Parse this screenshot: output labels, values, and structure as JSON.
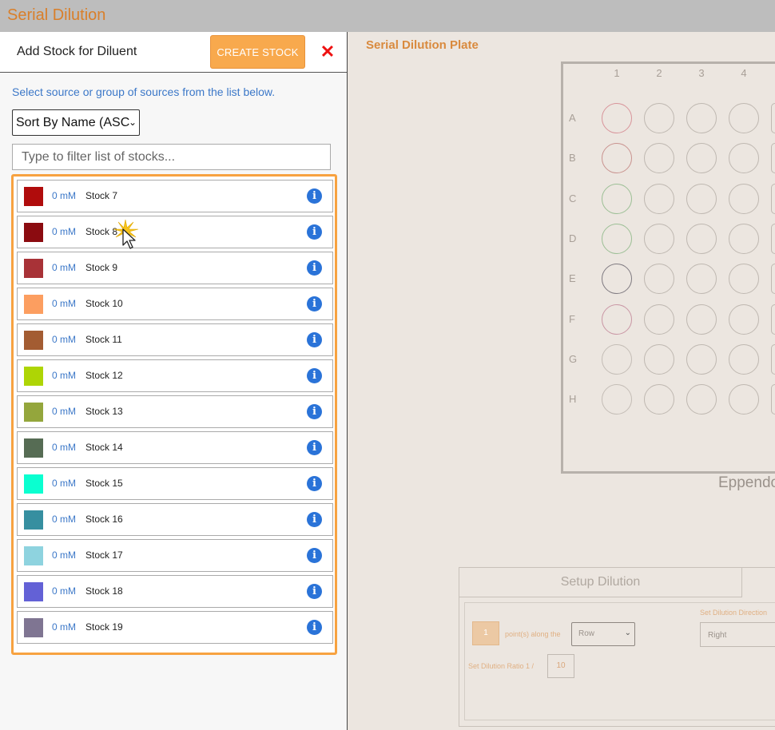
{
  "app": {
    "title": "Serial Dilution"
  },
  "panel": {
    "title": "Add Stock for Diluent",
    "create_label": "CREATE STOCK",
    "close_glyph": "✕",
    "instructions": "Select source or group of sources from the list below.",
    "sort_value": "Sort By Name (ASC",
    "filter_placeholder": "Type to filter list of stocks..."
  },
  "stocks": [
    {
      "conc": "0 mM",
      "name": "Stock 7",
      "color": "#b00c0c"
    },
    {
      "conc": "0 mM",
      "name": "Stock 8",
      "color": "#8b0b10"
    },
    {
      "conc": "0 mM",
      "name": "Stock 9",
      "color": "#a83237"
    },
    {
      "conc": "0 mM",
      "name": "Stock 10",
      "color": "#fc9e60"
    },
    {
      "conc": "0 mM",
      "name": "Stock 11",
      "color": "#a35c32"
    },
    {
      "conc": "0 mM",
      "name": "Stock 12",
      "color": "#aed505"
    },
    {
      "conc": "0 mM",
      "name": "Stock 13",
      "color": "#94a63c"
    },
    {
      "conc": "0 mM",
      "name": "Stock 14",
      "color": "#566c54"
    },
    {
      "conc": "0 mM",
      "name": "Stock 15",
      "color": "#0affd0"
    },
    {
      "conc": "0 mM",
      "name": "Stock 16",
      "color": "#368fa0"
    },
    {
      "conc": "0 mM",
      "name": "Stock 17",
      "color": "#8ed3df"
    },
    {
      "conc": "0 mM",
      "name": "Stock 18",
      "color": "#6361d6"
    },
    {
      "conc": "0 mM",
      "name": "Stock 19",
      "color": "#7f7592"
    }
  ],
  "plate": {
    "title": "Serial Dilution Plate",
    "columns": [
      "1",
      "2",
      "3",
      "4"
    ],
    "rows": [
      "A",
      "B",
      "C",
      "D",
      "E",
      "F",
      "G",
      "H"
    ],
    "first_column_colors": [
      "#d8949a",
      "#c9938f",
      "#9cbf95",
      "#9cbf95",
      "#7f7a80",
      "#c996a4",
      "#c4bdb6",
      "#c4bdb6"
    ],
    "caption": "Eppendo"
  },
  "setup": {
    "tab_label": "Setup Dilution",
    "points_value": "1",
    "points_label": "point(s) along the",
    "direction_value": "Row",
    "direction_label": "Set Dilution Direction",
    "right_value": "Right",
    "ratio_label": "Set Dilution Ratio  1 /",
    "ratio_value": "10"
  }
}
